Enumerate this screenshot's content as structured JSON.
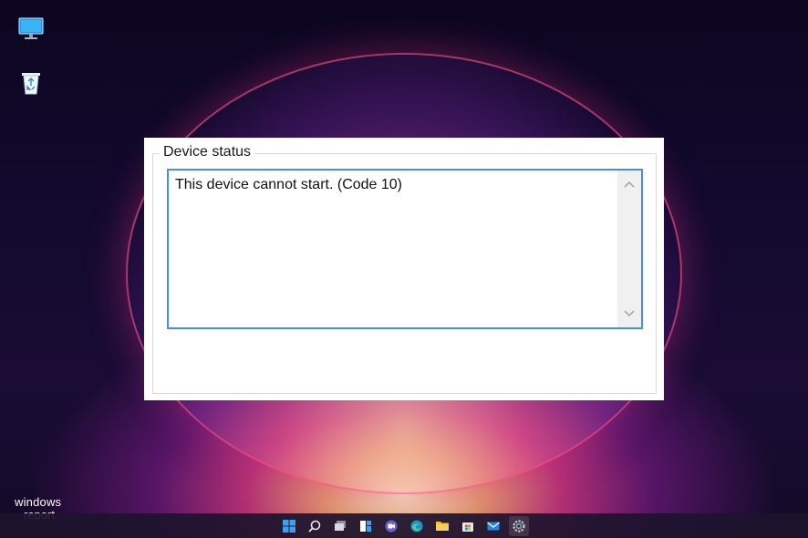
{
  "desktop": {
    "icons": [
      {
        "name": "This PC",
        "icon": "monitor-icon"
      },
      {
        "name": "Recycle Bin",
        "icon": "recycle-bin-icon"
      }
    ]
  },
  "dialog": {
    "group_title": "Device status",
    "status_text": "This device cannot start. (Code 10)"
  },
  "watermark": {
    "line1": "windows",
    "line2": "report"
  },
  "taskbar": {
    "icons": [
      "start-icon",
      "search-icon",
      "task-view-icon",
      "widgets-icon",
      "chat-icon",
      "edge-icon",
      "file-explorer-icon",
      "store-icon",
      "mail-icon",
      "settings-icon"
    ],
    "active": "settings-icon",
    "accent_color": "#0078d4"
  }
}
